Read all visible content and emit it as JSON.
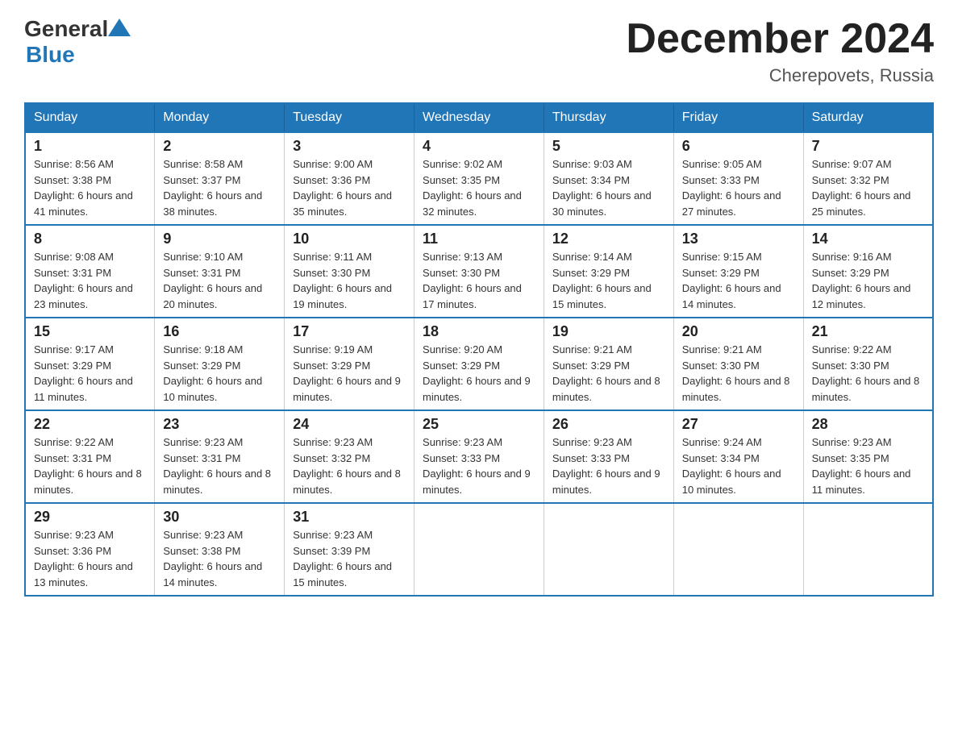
{
  "header": {
    "logo_general": "General",
    "logo_blue": "Blue",
    "month_title": "December 2024",
    "location": "Cherepovets, Russia"
  },
  "days_of_week": [
    "Sunday",
    "Monday",
    "Tuesday",
    "Wednesday",
    "Thursday",
    "Friday",
    "Saturday"
  ],
  "weeks": [
    [
      {
        "day": "1",
        "sunrise": "8:56 AM",
        "sunset": "3:38 PM",
        "daylight": "6 hours and 41 minutes."
      },
      {
        "day": "2",
        "sunrise": "8:58 AM",
        "sunset": "3:37 PM",
        "daylight": "6 hours and 38 minutes."
      },
      {
        "day": "3",
        "sunrise": "9:00 AM",
        "sunset": "3:36 PM",
        "daylight": "6 hours and 35 minutes."
      },
      {
        "day": "4",
        "sunrise": "9:02 AM",
        "sunset": "3:35 PM",
        "daylight": "6 hours and 32 minutes."
      },
      {
        "day": "5",
        "sunrise": "9:03 AM",
        "sunset": "3:34 PM",
        "daylight": "6 hours and 30 minutes."
      },
      {
        "day": "6",
        "sunrise": "9:05 AM",
        "sunset": "3:33 PM",
        "daylight": "6 hours and 27 minutes."
      },
      {
        "day": "7",
        "sunrise": "9:07 AM",
        "sunset": "3:32 PM",
        "daylight": "6 hours and 25 minutes."
      }
    ],
    [
      {
        "day": "8",
        "sunrise": "9:08 AM",
        "sunset": "3:31 PM",
        "daylight": "6 hours and 23 minutes."
      },
      {
        "day": "9",
        "sunrise": "9:10 AM",
        "sunset": "3:31 PM",
        "daylight": "6 hours and 20 minutes."
      },
      {
        "day": "10",
        "sunrise": "9:11 AM",
        "sunset": "3:30 PM",
        "daylight": "6 hours and 19 minutes."
      },
      {
        "day": "11",
        "sunrise": "9:13 AM",
        "sunset": "3:30 PM",
        "daylight": "6 hours and 17 minutes."
      },
      {
        "day": "12",
        "sunrise": "9:14 AM",
        "sunset": "3:29 PM",
        "daylight": "6 hours and 15 minutes."
      },
      {
        "day": "13",
        "sunrise": "9:15 AM",
        "sunset": "3:29 PM",
        "daylight": "6 hours and 14 minutes."
      },
      {
        "day": "14",
        "sunrise": "9:16 AM",
        "sunset": "3:29 PM",
        "daylight": "6 hours and 12 minutes."
      }
    ],
    [
      {
        "day": "15",
        "sunrise": "9:17 AM",
        "sunset": "3:29 PM",
        "daylight": "6 hours and 11 minutes."
      },
      {
        "day": "16",
        "sunrise": "9:18 AM",
        "sunset": "3:29 PM",
        "daylight": "6 hours and 10 minutes."
      },
      {
        "day": "17",
        "sunrise": "9:19 AM",
        "sunset": "3:29 PM",
        "daylight": "6 hours and 9 minutes."
      },
      {
        "day": "18",
        "sunrise": "9:20 AM",
        "sunset": "3:29 PM",
        "daylight": "6 hours and 9 minutes."
      },
      {
        "day": "19",
        "sunrise": "9:21 AM",
        "sunset": "3:29 PM",
        "daylight": "6 hours and 8 minutes."
      },
      {
        "day": "20",
        "sunrise": "9:21 AM",
        "sunset": "3:30 PM",
        "daylight": "6 hours and 8 minutes."
      },
      {
        "day": "21",
        "sunrise": "9:22 AM",
        "sunset": "3:30 PM",
        "daylight": "6 hours and 8 minutes."
      }
    ],
    [
      {
        "day": "22",
        "sunrise": "9:22 AM",
        "sunset": "3:31 PM",
        "daylight": "6 hours and 8 minutes."
      },
      {
        "day": "23",
        "sunrise": "9:23 AM",
        "sunset": "3:31 PM",
        "daylight": "6 hours and 8 minutes."
      },
      {
        "day": "24",
        "sunrise": "9:23 AM",
        "sunset": "3:32 PM",
        "daylight": "6 hours and 8 minutes."
      },
      {
        "day": "25",
        "sunrise": "9:23 AM",
        "sunset": "3:33 PM",
        "daylight": "6 hours and 9 minutes."
      },
      {
        "day": "26",
        "sunrise": "9:23 AM",
        "sunset": "3:33 PM",
        "daylight": "6 hours and 9 minutes."
      },
      {
        "day": "27",
        "sunrise": "9:24 AM",
        "sunset": "3:34 PM",
        "daylight": "6 hours and 10 minutes."
      },
      {
        "day": "28",
        "sunrise": "9:23 AM",
        "sunset": "3:35 PM",
        "daylight": "6 hours and 11 minutes."
      }
    ],
    [
      {
        "day": "29",
        "sunrise": "9:23 AM",
        "sunset": "3:36 PM",
        "daylight": "6 hours and 13 minutes."
      },
      {
        "day": "30",
        "sunrise": "9:23 AM",
        "sunset": "3:38 PM",
        "daylight": "6 hours and 14 minutes."
      },
      {
        "day": "31",
        "sunrise": "9:23 AM",
        "sunset": "3:39 PM",
        "daylight": "6 hours and 15 minutes."
      },
      null,
      null,
      null,
      null
    ]
  ]
}
